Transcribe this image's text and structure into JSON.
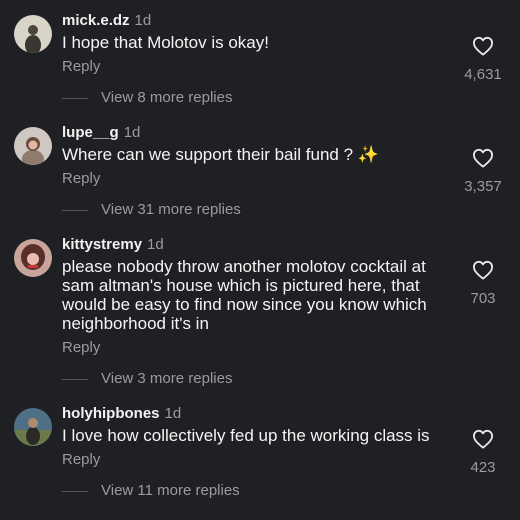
{
  "comments": [
    {
      "username": "mick.e.dz",
      "time": "1d",
      "text": "I hope that Molotov is okay!",
      "reply": "Reply",
      "likes": "4,631",
      "view_replies": "View 8 more replies"
    },
    {
      "username": "lupe__g",
      "time": "1d",
      "text": "Where can we support their bail fund ? ✨",
      "reply": "Reply",
      "likes": "3,357",
      "view_replies": "View 31 more replies"
    },
    {
      "username": "kittystremy",
      "time": "1d",
      "text": "please nobody throw another molotov cocktail at sam altman's house which is pictured here, that would be easy to find now since you know which neighborhood it's in",
      "reply": "Reply",
      "likes": "703",
      "view_replies": "View 3 more replies"
    },
    {
      "username": "holyhipbones",
      "time": "1d",
      "text": "I love how collectively fed up the working class is",
      "reply": "Reply",
      "likes": "423",
      "view_replies": "View 11 more replies"
    }
  ],
  "icons": {
    "like": "heart-outline-icon"
  },
  "colors": {
    "background": "#1f2024",
    "secondary_text": "#9a9ba0",
    "primary_text": "#f2f2f2"
  }
}
